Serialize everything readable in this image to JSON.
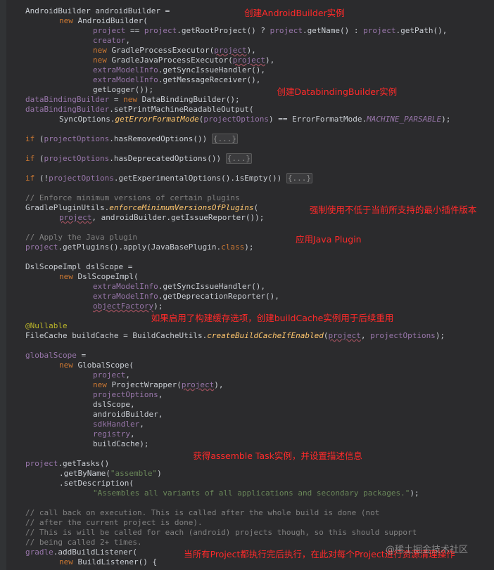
{
  "code_lines": [
    {
      "indent": 0,
      "segs": [
        {
          "t": "AndroidBuilder androidBuilder ="
        }
      ]
    },
    {
      "indent": 1,
      "segs": [
        {
          "t": "new ",
          "c": "kw"
        },
        {
          "t": "AndroidBuilder("
        }
      ]
    },
    {
      "indent": 2,
      "segs": [
        {
          "t": "project",
          "c": "f"
        },
        {
          "t": " == "
        },
        {
          "t": "project",
          "c": "f"
        },
        {
          "t": ".getRootProject() ? "
        },
        {
          "t": "project",
          "c": "f"
        },
        {
          "t": ".getName() : "
        },
        {
          "t": "project",
          "c": "f"
        },
        {
          "t": ".getPath(),"
        }
      ]
    },
    {
      "indent": 2,
      "segs": [
        {
          "t": "creator",
          "c": "f"
        },
        {
          "t": ","
        }
      ]
    },
    {
      "indent": 2,
      "segs": [
        {
          "t": "new ",
          "c": "kw"
        },
        {
          "t": "GradleProcessExecutor("
        },
        {
          "t": "project",
          "c": "f",
          "u": true
        },
        {
          "t": "),"
        }
      ]
    },
    {
      "indent": 2,
      "segs": [
        {
          "t": "new ",
          "c": "kw"
        },
        {
          "t": "GradleJavaProcessExecutor("
        },
        {
          "t": "project",
          "c": "f",
          "u": true
        },
        {
          "t": "),"
        }
      ]
    },
    {
      "indent": 2,
      "segs": [
        {
          "t": "extraModelInfo",
          "c": "f"
        },
        {
          "t": ".getSyncIssueHandler(),"
        }
      ]
    },
    {
      "indent": 2,
      "segs": [
        {
          "t": "extraModelInfo",
          "c": "f"
        },
        {
          "t": ".getMessageReceiver(),"
        }
      ]
    },
    {
      "indent": 2,
      "segs": [
        {
          "t": "getLogger());"
        }
      ]
    },
    {
      "indent": 0,
      "segs": [
        {
          "t": "dataBindingBuilder",
          "c": "f"
        },
        {
          "t": " = "
        },
        {
          "t": "new ",
          "c": "kw"
        },
        {
          "t": "DataBindingBuilder();"
        }
      ]
    },
    {
      "indent": 0,
      "segs": [
        {
          "t": "dataBindingBuilder",
          "c": "f"
        },
        {
          "t": ".setPrintMachineReadableOutput("
        }
      ]
    },
    {
      "indent": 1,
      "segs": [
        {
          "t": "SyncOptions."
        },
        {
          "t": "getErrorFormatMode",
          "c": "it"
        },
        {
          "t": "("
        },
        {
          "t": "projectOptions",
          "c": "f"
        },
        {
          "t": ") == ErrorFormatMode."
        },
        {
          "t": "MACHINE_PARSABLE",
          "c": "fi"
        },
        {
          "t": ");"
        }
      ]
    },
    {
      "indent": 0,
      "segs": []
    },
    {
      "indent": 0,
      "segs": [
        {
          "t": "if ",
          "c": "kw"
        },
        {
          "t": "("
        },
        {
          "t": "projectOptions",
          "c": "f"
        },
        {
          "t": ".hasRemovedOptions()) "
        },
        {
          "t": "{...}",
          "c": "fold"
        }
      ]
    },
    {
      "indent": 0,
      "segs": []
    },
    {
      "indent": 0,
      "segs": [
        {
          "t": "if ",
          "c": "kw"
        },
        {
          "t": "("
        },
        {
          "t": "projectOptions",
          "c": "f"
        },
        {
          "t": ".hasDeprecatedOptions()) "
        },
        {
          "t": "{...}",
          "c": "fold"
        }
      ]
    },
    {
      "indent": 0,
      "segs": []
    },
    {
      "indent": 0,
      "segs": [
        {
          "t": "if ",
          "c": "kw"
        },
        {
          "t": "(!"
        },
        {
          "t": "projectOptions",
          "c": "f"
        },
        {
          "t": ".getExperimentalOptions().isEmpty()) "
        },
        {
          "t": "{...}",
          "c": "fold"
        }
      ]
    },
    {
      "indent": 0,
      "segs": []
    },
    {
      "indent": 0,
      "segs": [
        {
          "t": "// Enforce minimum versions of certain plugins",
          "c": "cm"
        }
      ]
    },
    {
      "indent": 0,
      "segs": [
        {
          "t": "GradlePluginUtils."
        },
        {
          "t": "enforceMinimumVersionsOfPlugins",
          "c": "it"
        },
        {
          "t": "("
        }
      ]
    },
    {
      "indent": 1,
      "segs": [
        {
          "t": "project",
          "c": "f",
          "u": true
        },
        {
          "t": ", androidBuilder.getIssueReporter());"
        }
      ]
    },
    {
      "indent": 0,
      "segs": []
    },
    {
      "indent": 0,
      "segs": [
        {
          "t": "// Apply the Java plugin",
          "c": "cm"
        }
      ]
    },
    {
      "indent": 0,
      "segs": [
        {
          "t": "project",
          "c": "f"
        },
        {
          "t": ".getPlugins().apply(JavaBasePlugin."
        },
        {
          "t": "class",
          "c": "kw"
        },
        {
          "t": ");"
        }
      ]
    },
    {
      "indent": 0,
      "segs": []
    },
    {
      "indent": 0,
      "segs": [
        {
          "t": "DslScopeImpl dslScope ="
        }
      ]
    },
    {
      "indent": 1,
      "segs": [
        {
          "t": "new ",
          "c": "kw"
        },
        {
          "t": "DslScopeImpl("
        }
      ]
    },
    {
      "indent": 2,
      "segs": [
        {
          "t": "extraModelInfo",
          "c": "f"
        },
        {
          "t": ".getSyncIssueHandler(),"
        }
      ]
    },
    {
      "indent": 2,
      "segs": [
        {
          "t": "extraModelInfo",
          "c": "f"
        },
        {
          "t": ".getDeprecationReporter(),"
        }
      ]
    },
    {
      "indent": 2,
      "segs": [
        {
          "t": "objectFactory",
          "c": "f",
          "u": true
        },
        {
          "t": ");"
        }
      ]
    },
    {
      "indent": 0,
      "segs": []
    },
    {
      "indent": 0,
      "segs": [
        {
          "t": "@Nullable",
          "c": "an"
        }
      ]
    },
    {
      "indent": 0,
      "segs": [
        {
          "t": "FileCache buildCache = BuildCacheUtils."
        },
        {
          "t": "createBuildCacheIfEnabled",
          "c": "it"
        },
        {
          "t": "("
        },
        {
          "t": "project",
          "c": "f",
          "u": true
        },
        {
          "t": ", "
        },
        {
          "t": "projectOptions",
          "c": "f"
        },
        {
          "t": ");"
        }
      ]
    },
    {
      "indent": 0,
      "segs": []
    },
    {
      "indent": 0,
      "segs": [
        {
          "t": "globalScope",
          "c": "f"
        },
        {
          "t": " ="
        }
      ]
    },
    {
      "indent": 1,
      "segs": [
        {
          "t": "new ",
          "c": "kw"
        },
        {
          "t": "GlobalScope("
        }
      ]
    },
    {
      "indent": 2,
      "segs": [
        {
          "t": "project",
          "c": "f"
        },
        {
          "t": ","
        }
      ]
    },
    {
      "indent": 2,
      "segs": [
        {
          "t": "new ",
          "c": "kw"
        },
        {
          "t": "ProjectWrapper("
        },
        {
          "t": "project",
          "c": "f",
          "u": true
        },
        {
          "t": "),"
        }
      ]
    },
    {
      "indent": 2,
      "segs": [
        {
          "t": "projectOptions",
          "c": "f"
        },
        {
          "t": ","
        }
      ]
    },
    {
      "indent": 2,
      "segs": [
        {
          "t": "dslScope,"
        }
      ]
    },
    {
      "indent": 2,
      "segs": [
        {
          "t": "androidBuilder,"
        }
      ]
    },
    {
      "indent": 2,
      "segs": [
        {
          "t": "sdkHandler",
          "c": "f"
        },
        {
          "t": ","
        }
      ]
    },
    {
      "indent": 2,
      "segs": [
        {
          "t": "registry",
          "c": "f"
        },
        {
          "t": ","
        }
      ]
    },
    {
      "indent": 2,
      "segs": [
        {
          "t": "buildCache);"
        }
      ]
    },
    {
      "indent": 0,
      "segs": []
    },
    {
      "indent": 0,
      "segs": [
        {
          "t": "project",
          "c": "f"
        },
        {
          "t": ".getTasks()"
        }
      ]
    },
    {
      "indent": 1,
      "segs": [
        {
          "t": ".getByName("
        },
        {
          "t": "\"assemble\"",
          "c": "str"
        },
        {
          "t": ")"
        }
      ]
    },
    {
      "indent": 1,
      "segs": [
        {
          "t": ".setDescription("
        }
      ]
    },
    {
      "indent": 2,
      "segs": [
        {
          "t": "\"Assembles all variants of all applications and secondary packages.\"",
          "c": "str"
        },
        {
          "t": ");"
        }
      ]
    },
    {
      "indent": 0,
      "segs": []
    },
    {
      "indent": 0,
      "segs": [
        {
          "t": "// call back on execution. This is called after the whole build is done (not",
          "c": "cm"
        }
      ]
    },
    {
      "indent": 0,
      "segs": [
        {
          "t": "// after the current project is done).",
          "c": "cm"
        }
      ]
    },
    {
      "indent": 0,
      "segs": [
        {
          "t": "// This is will be called for each (android) projects though, so this should support",
          "c": "cm"
        }
      ]
    },
    {
      "indent": 0,
      "segs": [
        {
          "t": "// being called 2+ times.",
          "c": "cm"
        }
      ]
    },
    {
      "indent": 0,
      "segs": [
        {
          "t": "gradle",
          "c": "f"
        },
        {
          "t": ".addBuildListener("
        }
      ]
    },
    {
      "indent": 1,
      "segs": [
        {
          "t": "new ",
          "c": "kw"
        },
        {
          "t": "BuildListener() {"
        }
      ]
    }
  ],
  "annotations": [
    {
      "text": "创建AndroidBuilder实例",
      "line": 0,
      "col": 47
    },
    {
      "text": "创建DatabindingBuilder实例",
      "line": 8,
      "col": 54
    },
    {
      "text": "强制使用不低于当前所支持的最小插件版本",
      "line": 20,
      "col": 61
    },
    {
      "text": "应用Java Plugin",
      "line": 23,
      "col": 58
    },
    {
      "text": "如果启用了构建缓存选项，创建buildCache实例用于后续重用",
      "line": 31,
      "col": 27
    },
    {
      "text": "获得assemble Task实例，并设置描述信息",
      "line": 45,
      "col": 36
    },
    {
      "text": "当所有Project都执行完后执行，在此对每个Project进行资源清理操作",
      "line": 55,
      "col": 34
    }
  ],
  "watermark": "@稀土掘金技术社区",
  "colors": {
    "background": "#2b2b2d",
    "text": "#c9cdd3",
    "keyword": "#cc7832",
    "method": "#ffc66d",
    "field": "#9876aa",
    "string": "#6a8759",
    "comment": "#808080",
    "annotation": "#bbb529",
    "note": "#ff2a2a"
  }
}
